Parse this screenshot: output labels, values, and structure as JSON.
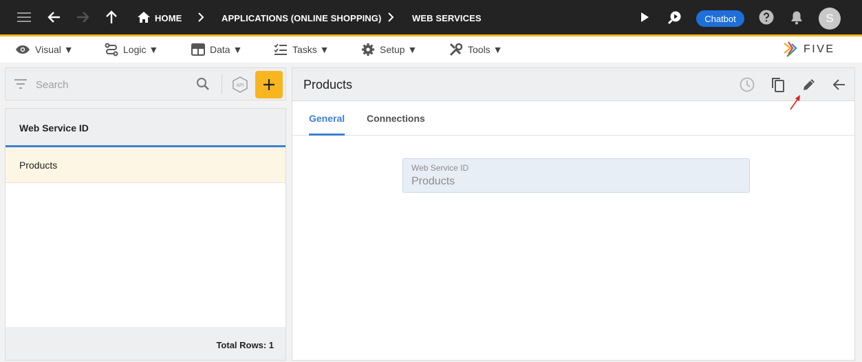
{
  "topbar": {
    "breadcrumb": [
      "HOME",
      "APPLICATIONS (ONLINE SHOPPING)",
      "WEB SERVICES"
    ],
    "chatbot_label": "Chatbot",
    "avatar_initial": "S"
  },
  "menu": [
    "Visual ▼",
    "Logic ▼",
    "Data ▼",
    "Tasks ▼",
    "Setup ▼",
    "Tools ▼"
  ],
  "logo": {
    "text": "FIVE"
  },
  "sidebar": {
    "search_placeholder": "Search",
    "api_badge": "API",
    "column_header": "Web Service ID",
    "rows": [
      "Products"
    ],
    "footer": "Total Rows: 1"
  },
  "detail": {
    "title": "Products",
    "tabs": [
      "General",
      "Connections"
    ],
    "field_label": "Web Service ID",
    "field_value": "Products"
  },
  "colors": {
    "topbar": "#232323",
    "accent": "#f5b320",
    "primary": "#3d7fd1",
    "chatbot": "#1e6fd9",
    "selected_row": "#fef6e4",
    "annotation_arrow": "#e02020"
  }
}
